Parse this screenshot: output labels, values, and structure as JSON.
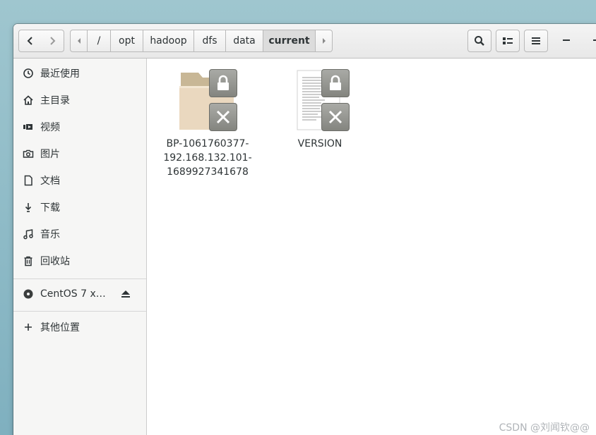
{
  "window": {
    "app": "Files"
  },
  "nav": {
    "back_icon": "chevron-left-icon",
    "forward_icon": "chevron-right-icon"
  },
  "path": {
    "segments": [
      "/",
      "opt",
      "hadoop",
      "dfs",
      "data",
      "current"
    ],
    "active": "current"
  },
  "header": {
    "search_icon": "search-icon",
    "view_icon": "list-view-icon",
    "menu_icon": "hamburger-menu-icon"
  },
  "sidebar": {
    "items": [
      {
        "label": "最近使用",
        "icon": "clock-icon"
      },
      {
        "label": "主目录",
        "icon": "home-icon"
      },
      {
        "label": "视频",
        "icon": "video-icon"
      },
      {
        "label": "图片",
        "icon": "camera-icon"
      },
      {
        "label": "文档",
        "icon": "document-icon"
      },
      {
        "label": "下载",
        "icon": "download-icon"
      },
      {
        "label": "音乐",
        "icon": "music-icon"
      },
      {
        "label": "回收站",
        "icon": "trash-icon"
      }
    ],
    "device": {
      "label": "CentOS 7 x…",
      "icon": "disc-icon",
      "eject_icon": "eject-icon"
    },
    "other": {
      "label": "其他位置",
      "icon": "plus-icon"
    }
  },
  "files": [
    {
      "name_lines": [
        "BP-1061760377-",
        "192.168.132.101-",
        "1689927341678"
      ],
      "type": "folder",
      "locked": true
    },
    {
      "name_lines": [
        "VERSION"
      ],
      "type": "text-file",
      "locked": true
    }
  ],
  "watermark": "CSDN @刘闻钦@@"
}
